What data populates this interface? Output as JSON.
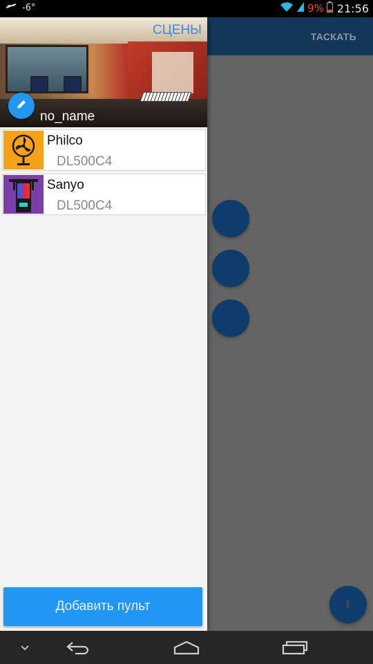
{
  "status_bar": {
    "notification_text": "-6°",
    "battery_percent": "9%",
    "time": "21:56",
    "icons": [
      "notification-icon",
      "wifi-icon",
      "signal-icon",
      "battery-icon"
    ]
  },
  "app_bar": {
    "action_label": "ТАСКАТЬ",
    "background": "#13365a"
  },
  "drawer": {
    "header": {
      "scenes_link": "СЦЕНЫ",
      "profile_name": "no_name",
      "edit_icon": "pencil-icon"
    },
    "remotes": [
      {
        "name": "Philco",
        "model": "DL500C4",
        "icon": "fan-icon",
        "icon_bg": "#f4a21a"
      },
      {
        "name": "Sanyo",
        "model": "DL500C4",
        "icon": "heater-icon",
        "icon_bg": "#7b3fa8"
      }
    ],
    "add_button_label": "Добавить пульт"
  },
  "colors": {
    "accent": "#2196f3",
    "dark_blue": "#0f3c6a",
    "scrim": "#646464"
  },
  "nav_bar": {
    "buttons": [
      "chevron-down-icon",
      "back-icon",
      "home-icon",
      "recents-icon"
    ]
  }
}
